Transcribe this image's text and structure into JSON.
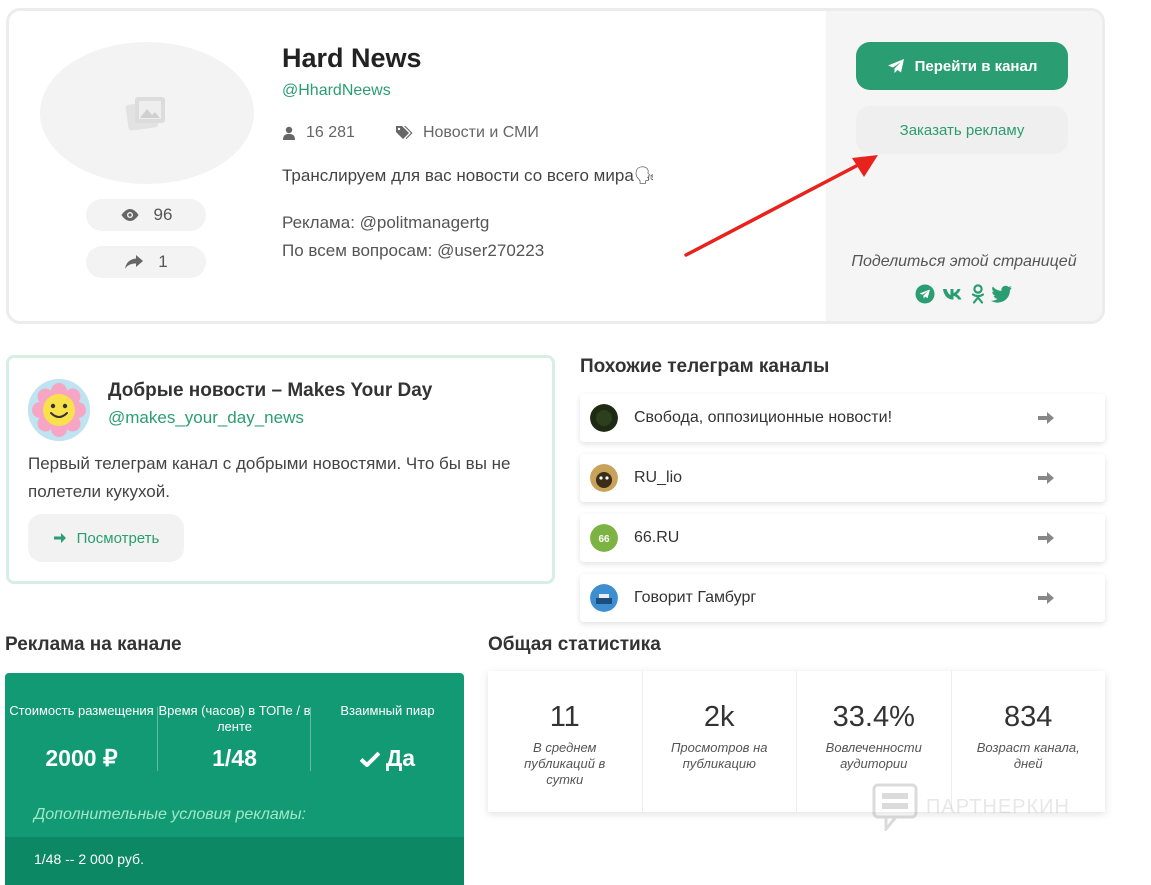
{
  "channel": {
    "title": "Hard News",
    "handle": "@HhardNeews",
    "subscribers": "16 281",
    "category": "Новости и СМИ",
    "description": "Транслируем для вас новости со всего мира🗣",
    "ad_contact": "Реклама: @politmanagertg",
    "questions_contact": "По всем вопросам: @user270223",
    "views": "96",
    "shares": "1"
  },
  "actions": {
    "go_channel": "Перейти в канал",
    "order_ad": "Заказать рекламу",
    "share_label": "Поделиться этой страницей"
  },
  "promo": {
    "title": "Добрые новости – Makes Your Day",
    "handle": "@makes_your_day_news",
    "description": "Первый телеграм канал с добрыми новостями. Что бы вы не полетели кукухой.",
    "button": "Посмотреть"
  },
  "similar": {
    "title": "Похожие телеграм каналы",
    "items": [
      {
        "name": "Свобода, оппозиционные новости!",
        "color": "#1e2a14"
      },
      {
        "name": "RU_lio",
        "color": "#6b5a2e"
      },
      {
        "name": "66.RU",
        "color": "#7cb342"
      },
      {
        "name": "Говорит Гамбург",
        "color": "#3d8fd1"
      }
    ]
  },
  "ads": {
    "title": "Реклама на канале",
    "cost_label": "Стоимость размещения",
    "cost_value": "2000 ₽",
    "time_label": "Время (часов) в ТОПе / в ленте",
    "time_value": "1/48",
    "mutual_label": "Взаимный пиар",
    "mutual_value": "Да",
    "extra_label": "Дополнительные условия рекламы:",
    "condition": "1/48 -- 2 000 руб."
  },
  "stats": {
    "title": "Общая статистика",
    "items": [
      {
        "value": "11",
        "caption": "В среднем публикаций в сутки"
      },
      {
        "value": "2k",
        "caption": "Просмотров на публикацию"
      },
      {
        "value": "33.4%",
        "caption": "Вовлеченности аудитории"
      },
      {
        "value": "834",
        "caption": "Возраст канала, дней"
      }
    ]
  },
  "watermark": "ПАРТНЕРКИН",
  "colors": {
    "accent": "#2a9d72",
    "ads_bg": "#119a73",
    "arrow": "#e8231e"
  }
}
